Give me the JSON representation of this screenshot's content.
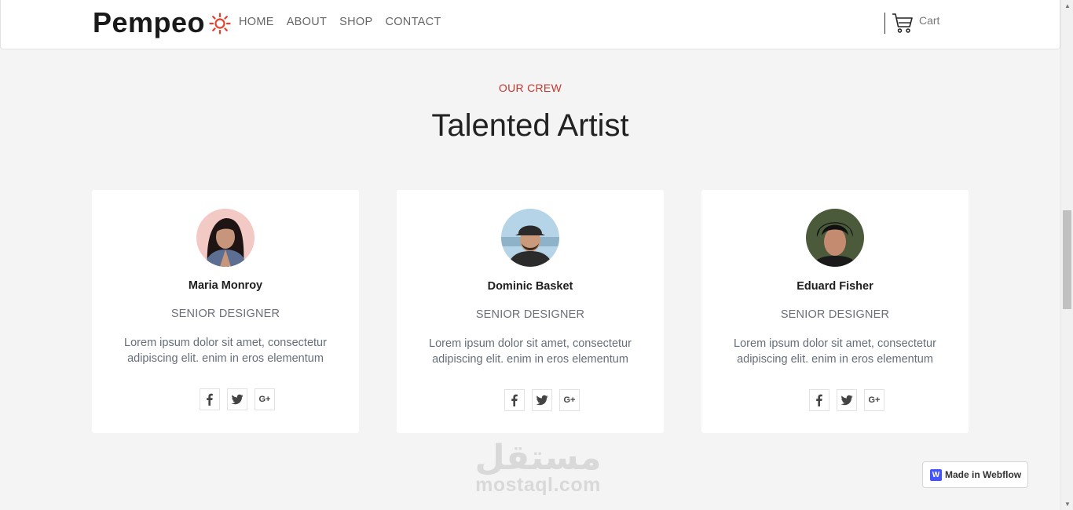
{
  "nav": {
    "brand": "Pempeo",
    "links": [
      "HOME",
      "ABOUT",
      "SHOP",
      "CONTACT"
    ],
    "cart_label": "Cart",
    "accent": "#e8412c"
  },
  "section": {
    "eyebrow": "OUR CREW",
    "title": "Talented Artist",
    "eyebrow_color": "#c6382e"
  },
  "team": [
    {
      "name": "Maria Monroy",
      "role": "SENIOR DESIGNER",
      "desc": "Lorem ipsum dolor sit amet, consectetur adipiscing elit. enim in eros elementum"
    },
    {
      "name": "Dominic Basket",
      "role": "SENIOR DESIGNER",
      "desc": "Lorem ipsum dolor sit amet, consectetur adipiscing elit. enim in eros elementum"
    },
    {
      "name": "Eduard Fisher",
      "role": "SENIOR DESIGNER",
      "desc": "Lorem ipsum dolor sit amet, consectetur adipiscing elit. enim in eros elementum"
    }
  ],
  "social_icons": [
    "facebook-icon",
    "twitter-icon",
    "google-plus-icon"
  ],
  "google_plus_glyph": "G+",
  "watermark": {
    "arabic": "مستقل",
    "url": "mostaql.com"
  },
  "badge": {
    "logo": "W",
    "label": "Made in Webflow",
    "color": "#4353ff"
  }
}
